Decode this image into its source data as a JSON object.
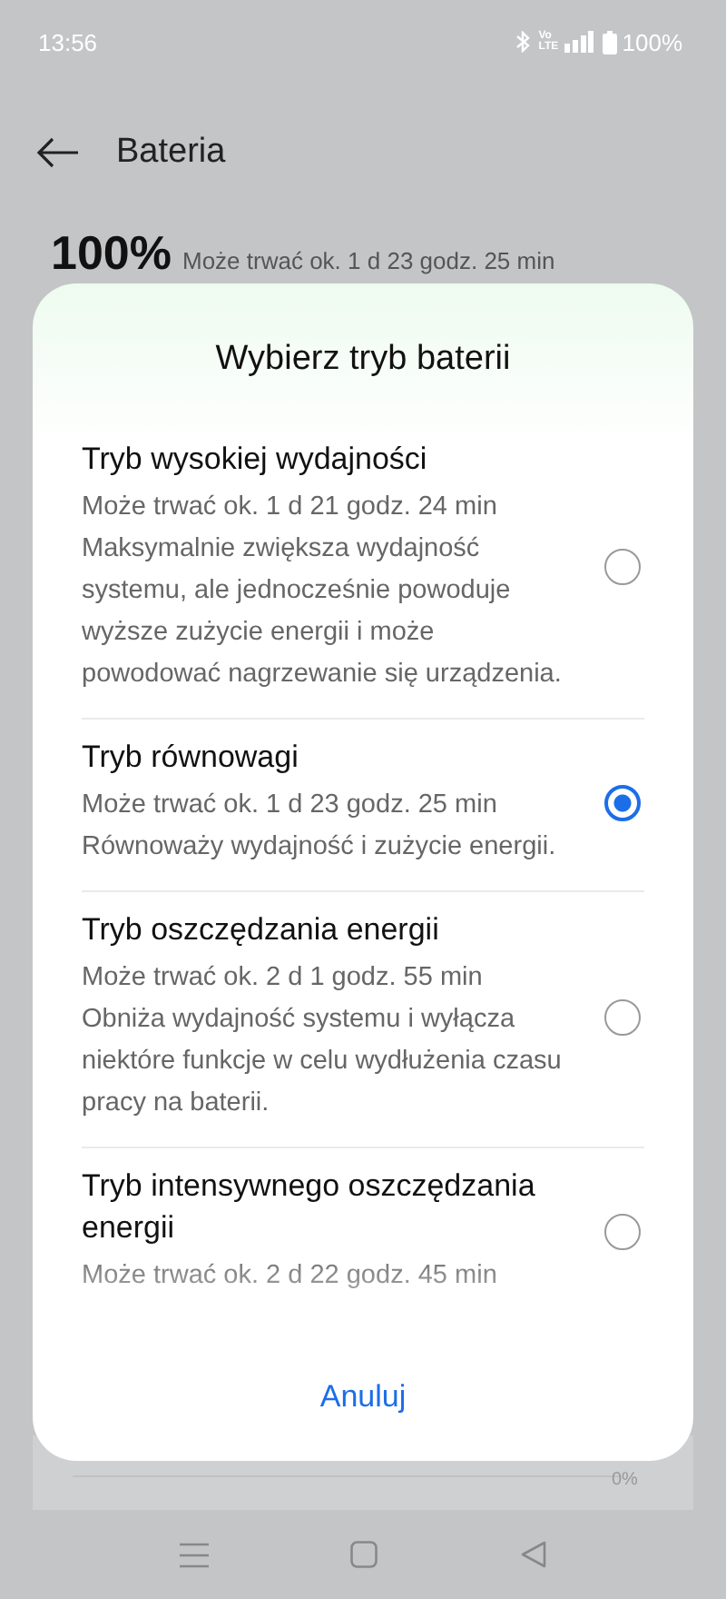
{
  "status_bar": {
    "time": "13:56",
    "network": "Vo LTE",
    "battery": "100%"
  },
  "header": {
    "title": "Bateria"
  },
  "battery_summary": {
    "percent": "100%",
    "estimate": "Może trwać ok. 1 d 23 godz. 25 min"
  },
  "usage_chart": {
    "axis_label": "0%"
  },
  "dialog": {
    "title": "Wybierz tryb baterii",
    "options": [
      {
        "title": "Tryb wysokiej wydajności",
        "estimate": "Może trwać ok. 1 d 21 godz. 24 min",
        "description": "Maksymalnie zwiększa wydajność systemu, ale jednocześnie powoduje wyższe zużycie energii i może powodować nagrzewanie się urządzenia.",
        "selected": false
      },
      {
        "title": "Tryb równowagi",
        "estimate": "Może trwać ok. 1 d 23 godz. 25 min",
        "description": "Równoważy wydajność i zużycie energii.",
        "selected": true
      },
      {
        "title": "Tryb oszczędzania energii",
        "estimate": "Może trwać ok. 2 d 1 godz. 55 min",
        "description": "Obniża wydajność systemu i wyłącza niektóre funkcje w celu wydłużenia czasu pracy na baterii.",
        "selected": false
      },
      {
        "title": "Tryb intensywnego oszczędzania energii",
        "estimate": "Może trwać ok. 2 d 22 godz. 45 min",
        "selected": false
      }
    ],
    "cancel": "Anuluj"
  }
}
